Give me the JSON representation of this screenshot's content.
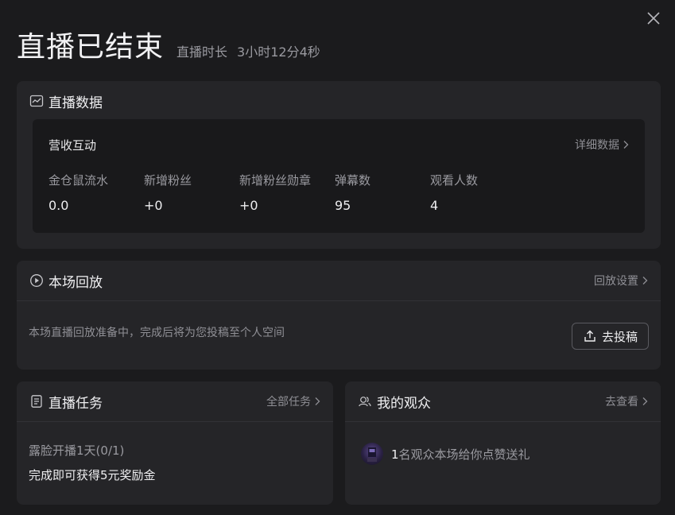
{
  "header": {
    "title": "直播已结束",
    "duration_label": "直播时长",
    "duration_value": "3小时12分4秒"
  },
  "live_data": {
    "title": "直播数据",
    "section_title": "营收互动",
    "detail_link": "详细数据",
    "stats": [
      {
        "label": "金仓鼠流水",
        "value": "0.0"
      },
      {
        "label": "新增粉丝",
        "value": "+0"
      },
      {
        "label": "新增粉丝勋章",
        "value": "+0"
      },
      {
        "label": "弹幕数",
        "value": "95"
      },
      {
        "label": "观看人数",
        "value": "4"
      }
    ]
  },
  "replay": {
    "title": "本场回放",
    "settings_link": "回放设置",
    "description": "本场直播回放准备中，完成后将为您投稿至个人空间",
    "upload_button": "去投稿"
  },
  "tasks": {
    "title": "直播任务",
    "all_link": "全部任务",
    "task_name": "露脸开播1天(0/1)",
    "task_reward": "完成即可获得5元奖励金"
  },
  "audience": {
    "title": "我的观众",
    "view_link": "去查看",
    "count": "1",
    "message": "名观众本场给你点赞送礼"
  },
  "icons": {
    "close": "close-icon",
    "chart": "chart-icon",
    "play": "play-icon",
    "upload": "upload-icon",
    "doc": "document-icon",
    "users": "users-icon",
    "chevron": "chevron-right-icon"
  }
}
